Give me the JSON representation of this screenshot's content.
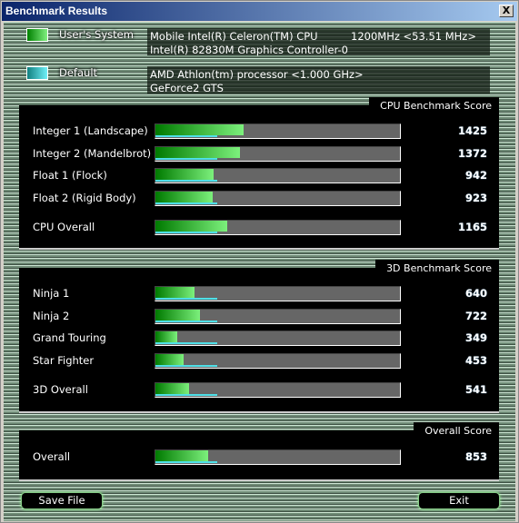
{
  "window": {
    "title": "Benchmark Results",
    "close_label": "X"
  },
  "systems": [
    {
      "label": "User's System",
      "swatch": "#22b422",
      "cpu": "Mobile Intel(R) Celeron(TM) CPU",
      "clock": "1200MHz <53.51 MHz>",
      "gpu": "Intel(R) 82830M Graphics Controller-0"
    },
    {
      "label": "Default",
      "swatch": "#30c8d0",
      "cpu": "AMD Athlon(tm) processor <1.000 GHz>",
      "clock": "",
      "gpu": "GeForce2 GTS"
    }
  ],
  "default_score": 1000,
  "bar_max": 4000,
  "cpu": {
    "title": "CPU Benchmark Score",
    "rows": [
      {
        "name": "Integer 1 (Landscape)",
        "score": "1425"
      },
      {
        "name": "Integer 2 (Mandelbrot)",
        "score": "1372"
      },
      {
        "name": "Float 1 (Flock)",
        "score": "942"
      },
      {
        "name": "Float 2 (Rigid Body)",
        "score": "923"
      }
    ],
    "overall": {
      "name": "CPU Overall",
      "score": "1165"
    }
  },
  "d3": {
    "title": "3D Benchmark Score",
    "rows": [
      {
        "name": "Ninja 1",
        "score": "640"
      },
      {
        "name": "Ninja 2",
        "score": "722"
      },
      {
        "name": "Grand Touring",
        "score": "349"
      },
      {
        "name": "Star Fighter",
        "score": "453"
      }
    ],
    "overall": {
      "name": "3D Overall",
      "score": "541"
    }
  },
  "total": {
    "title": "Overall Score",
    "overall": {
      "name": "Overall",
      "score": "853"
    }
  },
  "buttons": {
    "save": "Save File",
    "exit": "Exit"
  }
}
